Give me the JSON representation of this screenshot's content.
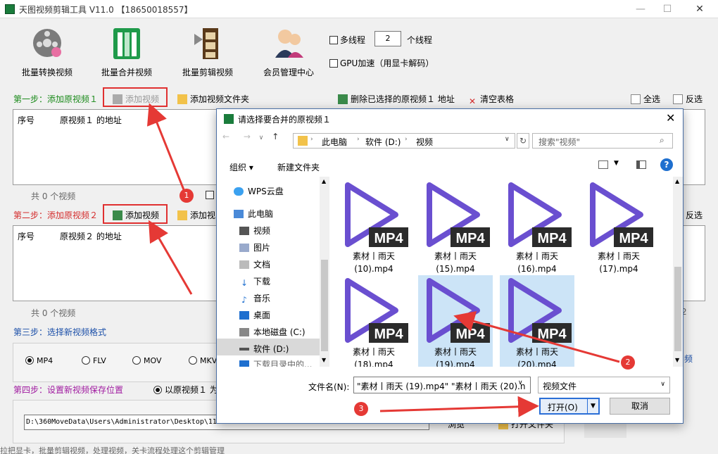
{
  "window": {
    "title": "天图视频剪辑工具 V11.0 【18650018557】",
    "minimize": "—",
    "maximize": "☐",
    "close": "✕"
  },
  "toolbar": {
    "tools": [
      {
        "label": "批量转换视频"
      },
      {
        "label": "批量合并视频"
      },
      {
        "label": "批量剪辑视频"
      },
      {
        "label": "会员管理中心"
      }
    ],
    "multithread_label": "多线程",
    "thread_count": "2",
    "thread_unit": "个线程",
    "gpu_label": "GPU加速（用显卡解码）"
  },
  "step1": {
    "title": "第一步：添加原视频１",
    "add_video": "添加视频",
    "add_folder": "添加视频文件夹",
    "delete_selected": "删除已选择的原视频１ 地址",
    "clear_table": "清空表格",
    "select_all": "全选",
    "invert": "反选",
    "col_index": "序号",
    "col_path": "原视频１ 的地址",
    "count": "共 0 个视频"
  },
  "step2": {
    "title": "第二步：添加原视频２",
    "add_video": "添加视频",
    "add_folder": "添加视",
    "invert": "反选",
    "col_index": "序号",
    "col_path": "原视频２ 的地址",
    "count": "共 0 个视频",
    "side_digit": "2"
  },
  "step3": {
    "title": "第三步：选择新视频格式",
    "formats": [
      "MP4",
      "FLV",
      "MOV",
      "MKV"
    ],
    "selected": "MP4",
    "side_link": "频"
  },
  "step4": {
    "title": "第四步：设置新视频保存位置",
    "option_label": "以原视频１ 为",
    "save_path": "D:\\360MoveData\\Users\\Administrator\\Desktop\\11...",
    "browse": "浏览",
    "open_folder": "打开文件夹"
  },
  "dialog": {
    "title": "请选择要合并的原视频１",
    "breadcrumb": [
      "此电脑",
      "软件 (D:)",
      "视频"
    ],
    "search_placeholder": "搜索\"视频\"",
    "organize": "组织 ▾",
    "new_folder": "新建文件夹",
    "nav_items": [
      "WPS云盘",
      "此电脑",
      "视频",
      "图片",
      "文档",
      "下载",
      "音乐",
      "桌面",
      "本地磁盘 (C:)",
      "软件 (D:)",
      "下载目录中的..."
    ],
    "files": [
      {
        "name1": "素材丨雨天",
        "name2": "(10).mp4",
        "selected": false
      },
      {
        "name1": "素材丨雨天",
        "name2": "(15).mp4",
        "selected": false
      },
      {
        "name1": "素材丨雨天",
        "name2": "(16).mp4",
        "selected": false
      },
      {
        "name1": "素材丨雨天",
        "name2": "(17).mp4",
        "selected": false
      },
      {
        "name1": "素材丨雨天",
        "name2": "(18).mp4",
        "selected": false
      },
      {
        "name1": "素材丨雨天",
        "name2": "(19).mp4",
        "selected": true
      },
      {
        "name1": "素材丨雨天",
        "name2": "(20).mp4",
        "selected": true
      }
    ],
    "badge_text": "MP4",
    "filename_label": "文件名(N):",
    "filename_value": "\"素材丨雨天 (19).mp4\" \"素材丨雨天 (20).n",
    "filetype": "视频文件",
    "open": "打开(O)",
    "cancel": "取消"
  },
  "annotations": [
    "1",
    "2",
    "3"
  ],
  "bottom_text": "拉把显卡，批量剪辑视频，处理视频，关卡流程处理这个剪辑管理",
  "colors": {
    "step_green": "#1a8a1a",
    "step_red": "#d42b2b",
    "step_blue": "#1b4fa8",
    "step_purple": "#a01aa0",
    "play_purple": "#6a4fd0",
    "arrow_red": "#e53935",
    "selection": "#cce4f7"
  }
}
